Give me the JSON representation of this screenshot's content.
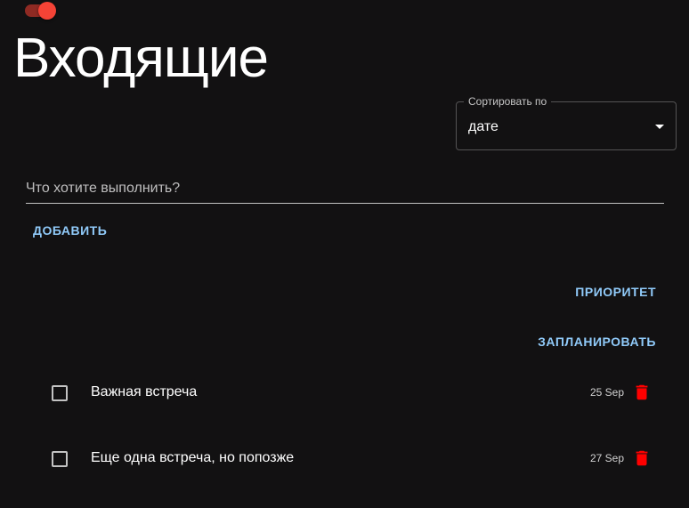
{
  "header": {
    "title": "Входящие",
    "theme_toggle": {
      "on": true,
      "color": "#f44336"
    }
  },
  "sort": {
    "label": "Сортировать по",
    "value": "дате"
  },
  "new_task": {
    "placeholder": "Что хотите выполнить?",
    "value": ""
  },
  "actions": {
    "add_label": "ДОБАВИТЬ",
    "priority_label": "ПРИОРИТЕТ",
    "schedule_label": "ЗАПЛАНИРОВАТЬ"
  },
  "tasks": [
    {
      "text": "Важная встреча",
      "date": "25 Sep",
      "done": false
    },
    {
      "text": "Еще одна встреча, но попозже",
      "date": "27 Sep",
      "done": false
    }
  ],
  "colors": {
    "background": "#121112",
    "accent": "#90caf9",
    "delete": "#ff0000"
  },
  "icons": {
    "sort_arrow": "arrow-drop-down-icon",
    "delete": "trash-icon"
  }
}
